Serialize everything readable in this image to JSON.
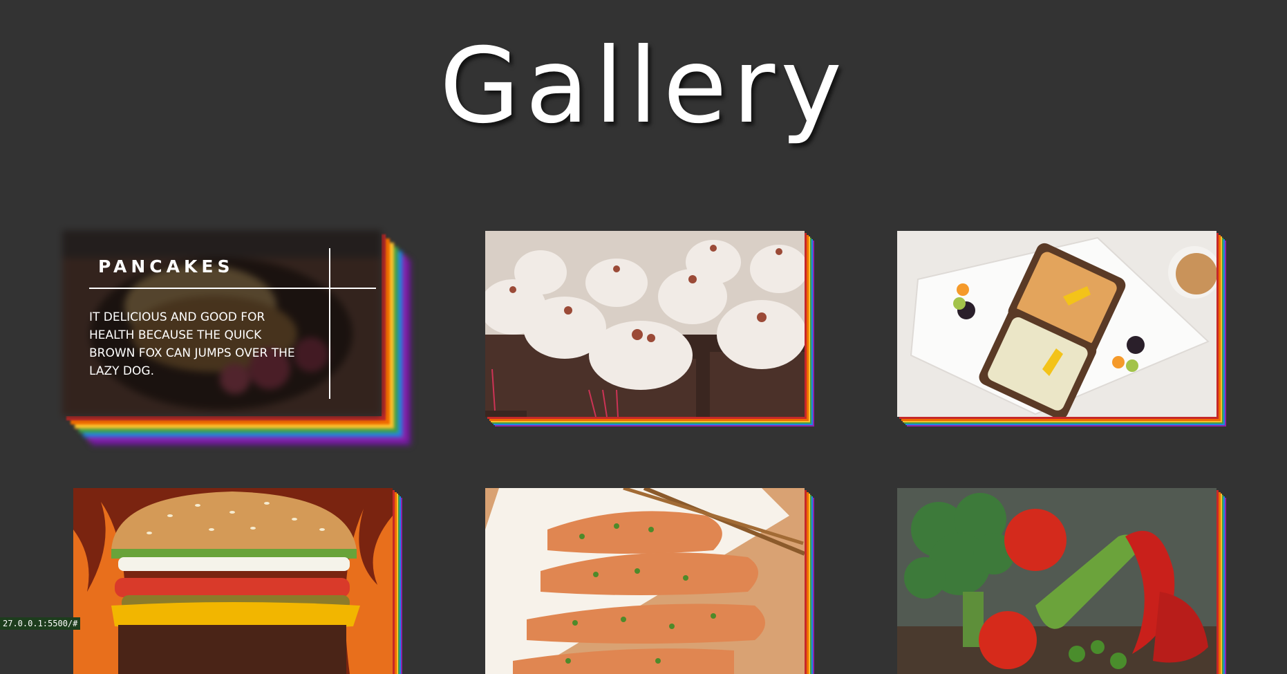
{
  "page": {
    "title": "Gallery"
  },
  "gallery": {
    "items": [
      {
        "title": "PANCAKES",
        "description": "IT DELICIOUS AND GOOD FOR HEALTH BECAUSE THE QUICK BROWN FOX CAN JUMPS OVER THE LAZY DOG.",
        "image": "pancakes"
      },
      {
        "image": "cupcakes"
      },
      {
        "image": "toast-plate"
      },
      {
        "image": "cheeseburger"
      },
      {
        "image": "salmon"
      },
      {
        "image": "vegetables"
      }
    ]
  },
  "status_bar": {
    "url": "27.0.0.1:5500/#"
  },
  "colors": {
    "background": "#333333",
    "text": "#ffffff",
    "shadow_stack": [
      "#c62828",
      "#ef6c00",
      "#fbc02d",
      "#43a047",
      "#1e88e5",
      "#8e24aa"
    ]
  }
}
